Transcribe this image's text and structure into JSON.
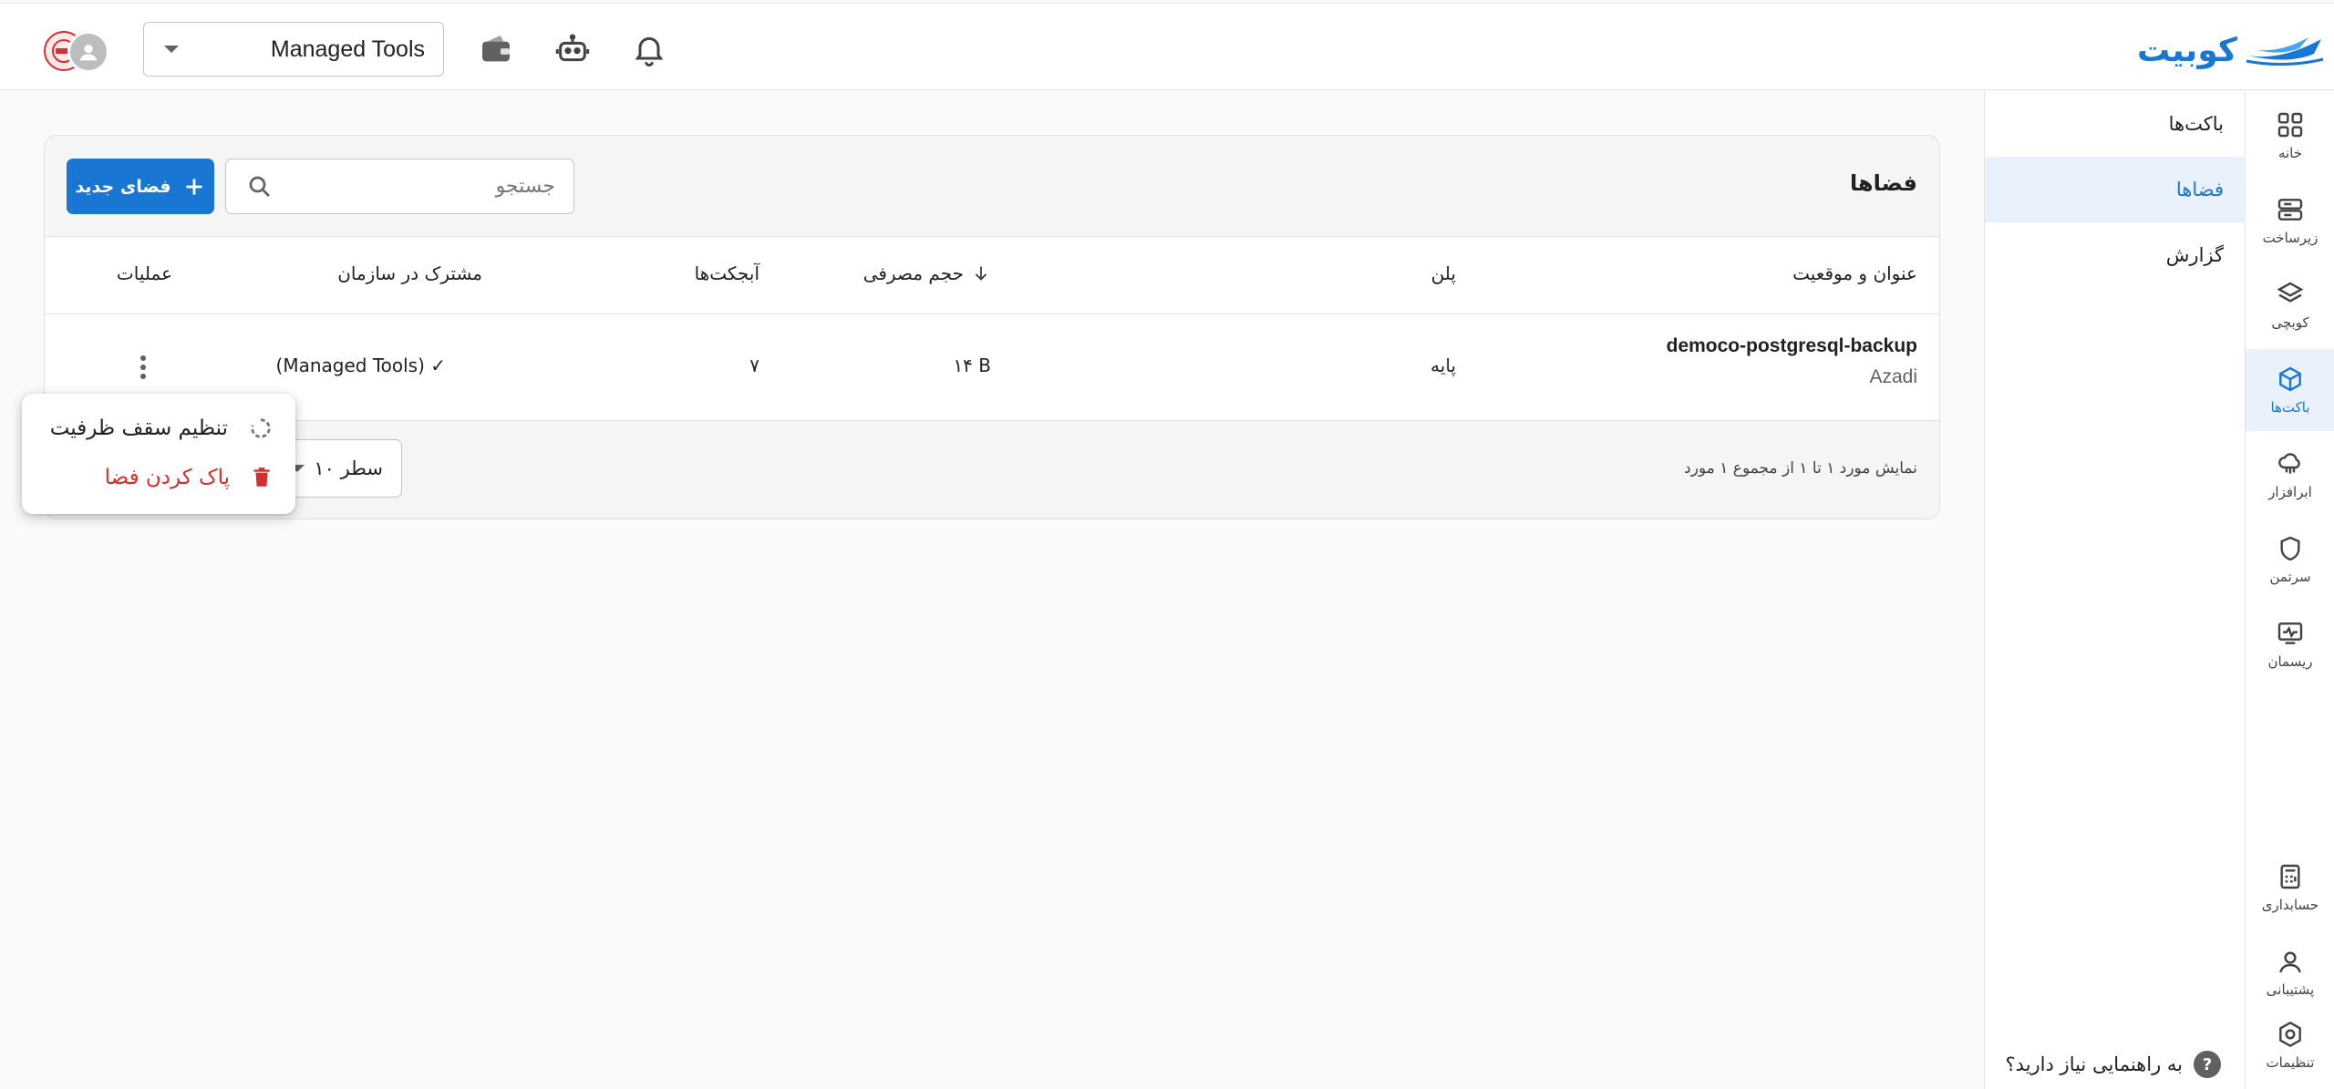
{
  "header": {
    "logo_text": "کوبیت",
    "org_selector": "Managed Tools",
    "icons": [
      "bell-icon",
      "robot-icon",
      "wallet-icon"
    ]
  },
  "rail": {
    "items": [
      {
        "label": "خانه",
        "icon": "grid-icon"
      },
      {
        "label": "زیرساخت",
        "icon": "server-icon"
      },
      {
        "label": "کوبچی",
        "icon": "layers-icon"
      },
      {
        "label": "باکت‌ها",
        "icon": "cube-icon",
        "active": true
      },
      {
        "label": "ابرافزار",
        "icon": "cloud-icon"
      },
      {
        "label": "سرتمن",
        "icon": "shield-icon"
      },
      {
        "label": "ریسمان",
        "icon": "monitor-icon"
      },
      {
        "label": "حسابداری",
        "icon": "calculator-icon"
      },
      {
        "label": "پشتیبانی",
        "icon": "support-icon"
      },
      {
        "label": "تنظیمات",
        "icon": "settings-icon"
      }
    ]
  },
  "subnav": {
    "title": "باکت‌ها",
    "items": [
      "فضاها",
      "گزارش"
    ],
    "help": "به راهنمایی نیاز دارید؟"
  },
  "main": {
    "title": "فضاها",
    "new_button": "فضای جدید",
    "search_placeholder": "جستجو",
    "columns": {
      "name": "عنوان و موقعیت",
      "plan": "پلن",
      "usage": "حجم مصرفی",
      "objects": "آبجکت‌ها",
      "shared": "مشترک در سازمان",
      "actions": "عملیات"
    },
    "rows": [
      {
        "name": "democo-postgresql-backup",
        "location": "Azadi",
        "plan": "پایه",
        "usage": "۱۴ B",
        "objects": "۷",
        "shared": "(Managed Tools) ✓"
      }
    ],
    "pagination_text": "نمایش مورد ۱ تا ۱ از مجموع ۱ مورد",
    "rows_per_page": "۱۰ سطر"
  },
  "menu": {
    "items": [
      {
        "label": "تنظیم سقف ظرفیت",
        "icon": "loading-circle-icon"
      },
      {
        "label": "پاک کردن فضا",
        "icon": "trash-icon",
        "color": "#d32f2f"
      }
    ]
  },
  "colors": {
    "accent": "#1976d2",
    "danger": "#d32f2f",
    "active_bg": "#e8f1fc"
  }
}
